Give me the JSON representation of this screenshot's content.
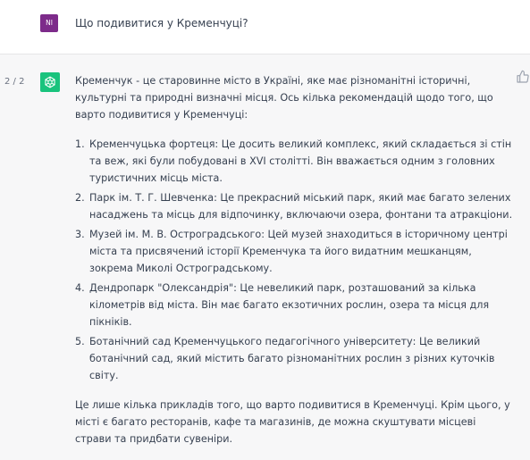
{
  "colors": {
    "user_avatar_bg": "#7d2b8a",
    "assistant_avatar_bg": "#19c37d",
    "assistant_row_bg": "#f7f7f8",
    "text": "#374151"
  },
  "user_message": {
    "avatar_initials": "NI",
    "text": "Що подивитися у Кременчуці?"
  },
  "assistant_message": {
    "pager": "2 / 2",
    "avatar_icon": "openai-logo-icon",
    "intro": "Кременчук - це старовинне місто в Україні, яке має різноманітні історичні, культурні та природні визначні місця. Ось кілька рекомендацій щодо того, що варто подивитися у Кременчуці:",
    "items": [
      {
        "number": "1.",
        "text": "Кременчуцька фортеця: Це досить великий комплекс, який складається зі стін та веж, які були побудовані в XVI столітті. Він вважається одним з головних туристичних місць міста."
      },
      {
        "number": "2.",
        "text": "Парк ім. Т. Г. Шевченка: Це прекрасний міський парк, який має багато зелених насаджень та місць для відпочинку, включаючи озера, фонтани та атракціони."
      },
      {
        "number": "3.",
        "text": "Музей ім. М. В. Остроградського: Цей музей знаходиться в історичному центрі міста та присвячений історії Кременчука та його видатним мешканцям, зокрема Миколі Остроградському."
      },
      {
        "number": "4.",
        "text": "Дендропарк \"Олександрія\": Це невеликий парк, розташований за кілька кілометрів від міста. Він має багато екзотичних рослин, озера та місця для пікніків."
      },
      {
        "number": "5.",
        "text": "Ботанічний сад Кременчуцького педагогічного університету: Це великий ботанічний сад, який містить багато різноманітних рослин з різних куточків світу."
      }
    ],
    "outro": "Це лише кілька прикладів того, що варто подивитися в Кременчуці. Крім цього, у місті є багато ресторанів, кафе та магазинів, де можна скуштувати місцеві страви та придбати сувеніри.",
    "action_icon": "thumbs-up-icon"
  }
}
